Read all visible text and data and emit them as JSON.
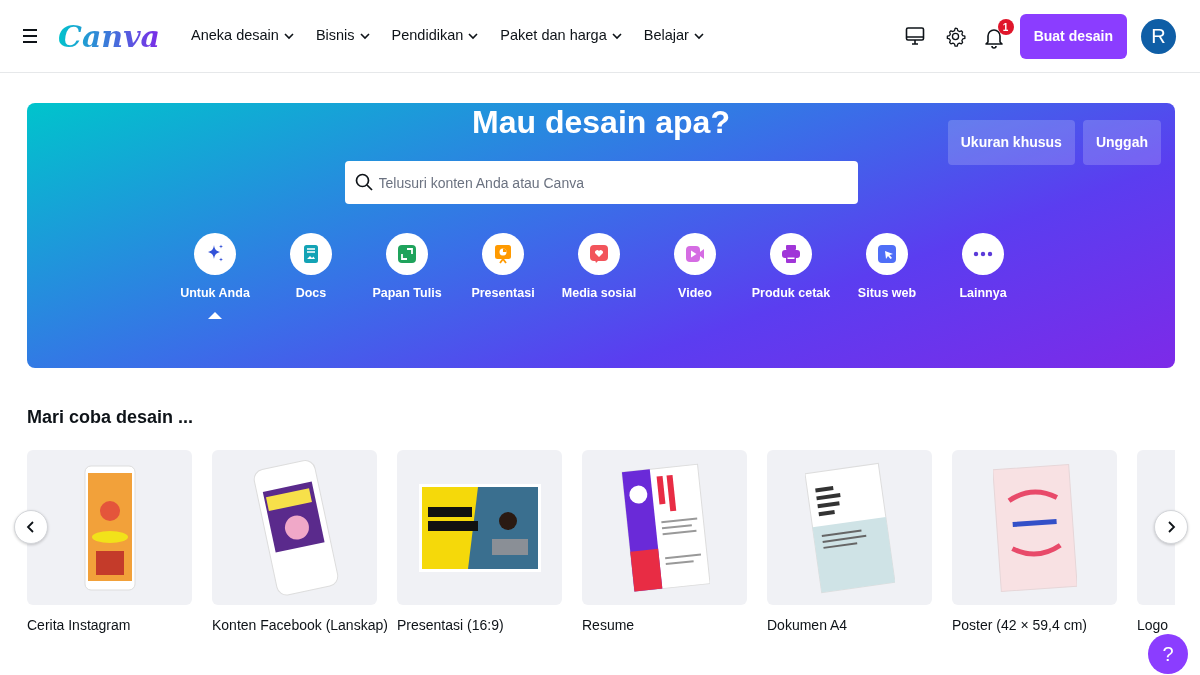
{
  "header": {
    "logo": "Canva",
    "menu": [
      {
        "label": "Aneka desain"
      },
      {
        "label": "Bisnis"
      },
      {
        "label": "Pendidikan"
      },
      {
        "label": "Paket dan harga"
      },
      {
        "label": "Belajar"
      }
    ],
    "notification_count": "1",
    "create_button": "Buat desain",
    "avatar_initial": "R"
  },
  "hero": {
    "title": "Mau desain apa?",
    "buttons": [
      "Ukuran khusus",
      "Unggah"
    ],
    "search": {
      "placeholder": "Telusuri konten Anda atau Canva"
    },
    "categories": [
      {
        "label": "Untuk Anda",
        "kind": "sparkle",
        "selected": true
      },
      {
        "label": "Docs",
        "kind": "docs",
        "selected": false
      },
      {
        "label": "Papan Tulis",
        "kind": "whiteboard",
        "selected": false
      },
      {
        "label": "Presentasi",
        "kind": "presentation",
        "selected": false
      },
      {
        "label": "Media sosial",
        "kind": "social",
        "selected": false
      },
      {
        "label": "Video",
        "kind": "video",
        "selected": false
      },
      {
        "label": "Produk cetak",
        "kind": "print",
        "selected": false
      },
      {
        "label": "Situs web",
        "kind": "website",
        "selected": false
      },
      {
        "label": "Lainnya",
        "kind": "more",
        "selected": false
      }
    ]
  },
  "templates": {
    "title": "Mari coba desain ...",
    "items": [
      {
        "label": "Cerita Instagram",
        "kind": "story"
      },
      {
        "label": "Konten Facebook (Lanskap)",
        "kind": "phone"
      },
      {
        "label": "Presentasi (16:9)",
        "kind": "slide"
      },
      {
        "label": "Resume",
        "kind": "resume"
      },
      {
        "label": "Dokumen A4",
        "kind": "document"
      },
      {
        "label": "Poster (42 × 59,4 cm)",
        "kind": "poster"
      },
      {
        "label": "Logo",
        "kind": "logo"
      }
    ]
  },
  "help_button": "?"
}
